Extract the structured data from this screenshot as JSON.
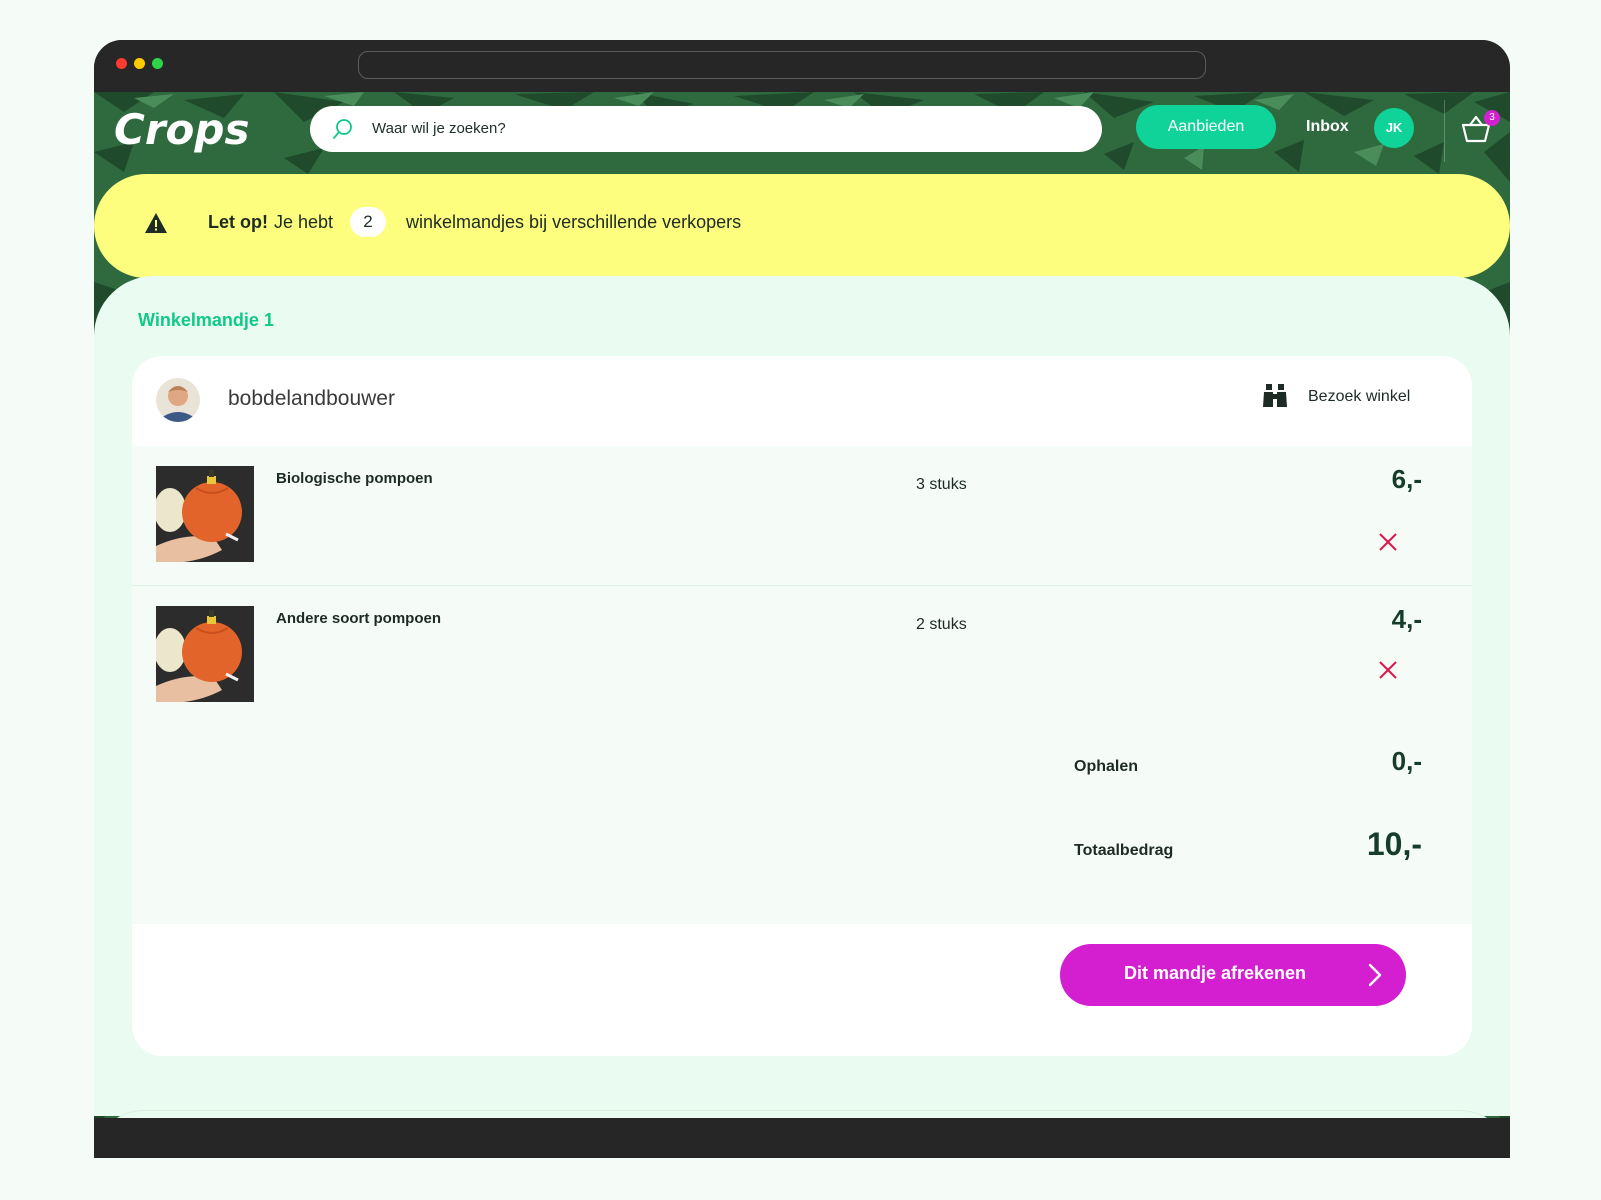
{
  "browser": {
    "address": ""
  },
  "header": {
    "logo_text": "Crops",
    "search_placeholder": "Waar wil je zoeken?",
    "offer_label": "Aanbieden",
    "inbox_label": "Inbox",
    "user_initials": "JK",
    "cart_count": "3"
  },
  "alert": {
    "bold": "Let op!",
    "prefix": "Je hebt",
    "count": "2",
    "suffix": "winkelmandjes bij verschillende verkopers"
  },
  "cart": {
    "title": "Winkelmandje 1",
    "seller": "bobdelandbouwer",
    "visit_label": "Bezoek winkel",
    "items": [
      {
        "name": "Biologische pompoen",
        "qty": "3 stuks",
        "price": "6,-"
      },
      {
        "name": "Andere soort pompoen",
        "qty": "2 stuks",
        "price": "4,-"
      }
    ],
    "pickup_label": "Ophalen",
    "pickup_price": "0,-",
    "total_label": "Totaalbedrag",
    "total_price": "10,-",
    "checkout_label": "Dit mandje afrekenen"
  },
  "colors": {
    "accent_green": "#10d39a",
    "checkout_magenta": "#d41fd1",
    "alert_yellow": "#fdfd7e",
    "remove_red": "#e0174b",
    "header_green": "#2e6a3e"
  }
}
